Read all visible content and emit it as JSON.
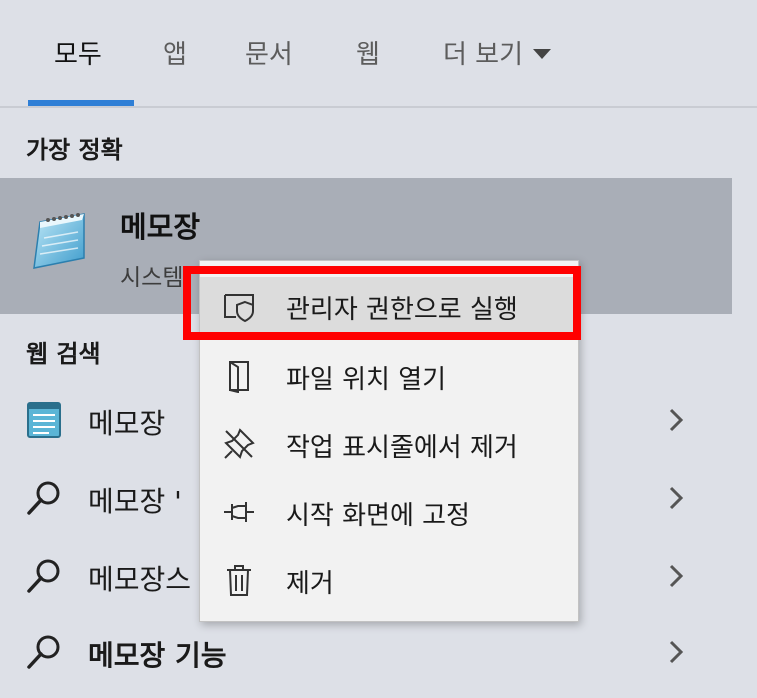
{
  "tabs": [
    {
      "label": "모두"
    },
    {
      "label": "앱"
    },
    {
      "label": "문서"
    },
    {
      "label": "웹"
    },
    {
      "label": "더 보기"
    }
  ],
  "best_match": {
    "section_label": "가장 정확",
    "title": "메모장",
    "subtitle": "시스템"
  },
  "web_search": {
    "section_label": "웹 검색",
    "items": [
      {
        "label": "메모장",
        "icon": "notepad-doc-icon"
      },
      {
        "label": "메모장 '",
        "icon": "search-icon"
      },
      {
        "label": "메모장스",
        "icon": "search-icon"
      },
      {
        "label": "메모장 기능",
        "icon": "search-icon"
      }
    ]
  },
  "context_menu": {
    "items": [
      {
        "label": "관리자 권한으로 실행",
        "icon": "shield-icon"
      },
      {
        "label": "파일 위치 열기",
        "icon": "folder-icon"
      },
      {
        "label": "작업 표시줄에서 제거",
        "icon": "unpin-icon"
      },
      {
        "label": "시작 화면에 고정",
        "icon": "pin-icon"
      },
      {
        "label": "제거",
        "icon": "trash-icon"
      }
    ]
  },
  "colors": {
    "accent": "#2f7fd6",
    "highlight_border": "#ff0000",
    "best_match_bg": "#a9aeb7",
    "background": "#dde0e7"
  }
}
